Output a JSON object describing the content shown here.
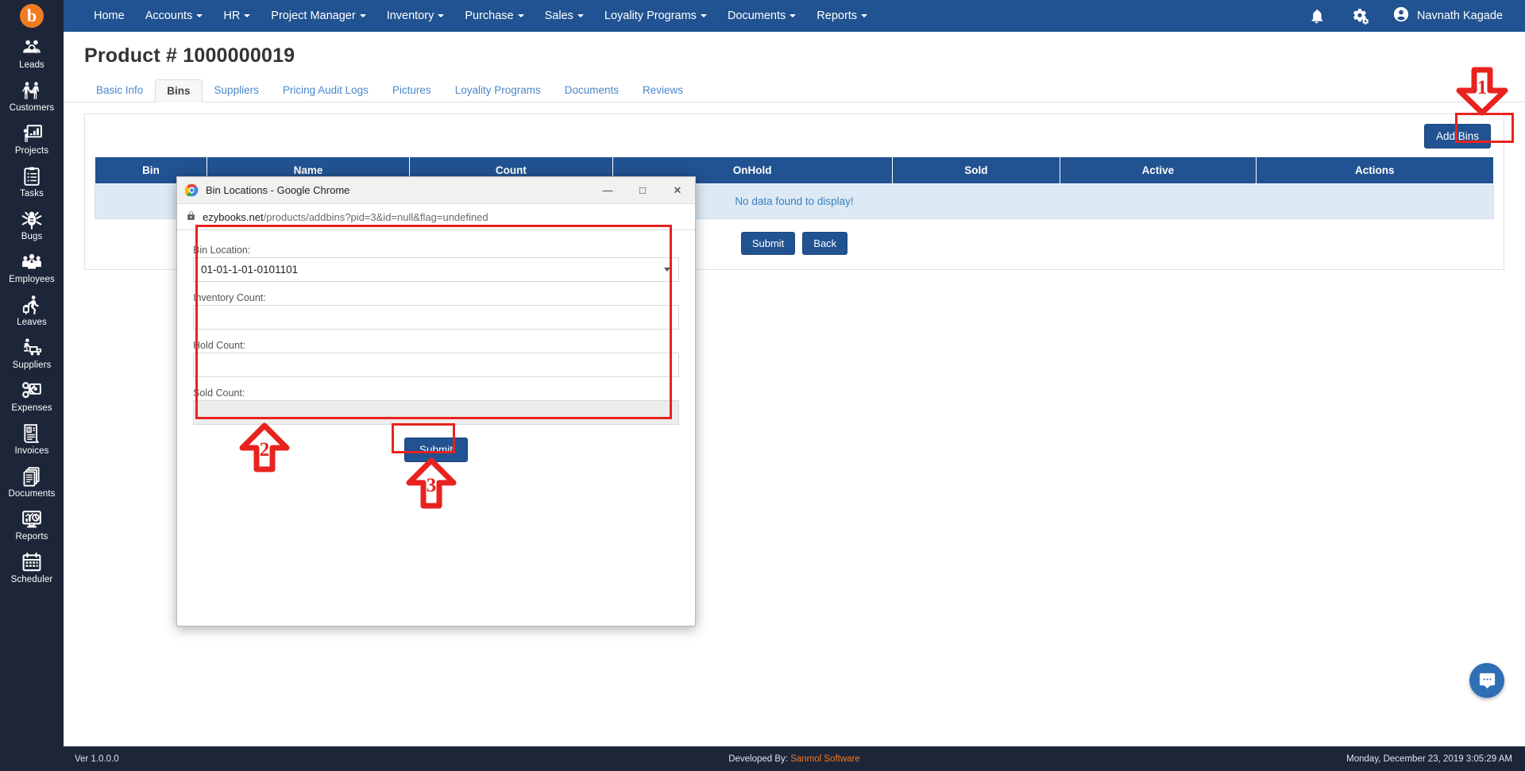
{
  "sidebar": {
    "logo": "b",
    "items": [
      {
        "label": "Leads",
        "icon": "leads-icon"
      },
      {
        "label": "Customers",
        "icon": "customers-icon"
      },
      {
        "label": "Projects",
        "icon": "projects-icon"
      },
      {
        "label": "Tasks",
        "icon": "tasks-icon"
      },
      {
        "label": "Bugs",
        "icon": "bugs-icon"
      },
      {
        "label": "Employees",
        "icon": "employees-icon"
      },
      {
        "label": "Leaves",
        "icon": "leaves-icon"
      },
      {
        "label": "Suppliers",
        "icon": "suppliers-icon"
      },
      {
        "label": "Expenses",
        "icon": "expenses-icon"
      },
      {
        "label": "Invoices",
        "icon": "invoices-icon"
      },
      {
        "label": "Documents",
        "icon": "documents-icon"
      },
      {
        "label": "Reports",
        "icon": "reports-icon"
      },
      {
        "label": "Scheduler",
        "icon": "scheduler-icon"
      }
    ]
  },
  "topnav": {
    "items": [
      {
        "label": "Home",
        "dropdown": false
      },
      {
        "label": "Accounts",
        "dropdown": true
      },
      {
        "label": "HR",
        "dropdown": true
      },
      {
        "label": "Project Manager",
        "dropdown": true
      },
      {
        "label": "Inventory",
        "dropdown": true
      },
      {
        "label": "Purchase",
        "dropdown": true
      },
      {
        "label": "Sales",
        "dropdown": true
      },
      {
        "label": "Loyality Programs",
        "dropdown": true
      },
      {
        "label": "Documents",
        "dropdown": true
      },
      {
        "label": "Reports",
        "dropdown": true
      }
    ],
    "notification_icon": "bell-icon",
    "settings_icon": "gears-icon",
    "user_name": "Navnath Kagade",
    "user_avatar_icon": "user-avatar-icon"
  },
  "page": {
    "title": "Product # 1000000019",
    "tabs": [
      {
        "label": "Basic Info",
        "active": false
      },
      {
        "label": "Bins",
        "active": true
      },
      {
        "label": "Suppliers",
        "active": false
      },
      {
        "label": "Pricing Audit Logs",
        "active": false
      },
      {
        "label": "Pictures",
        "active": false
      },
      {
        "label": "Loyality Programs",
        "active": false
      },
      {
        "label": "Documents",
        "active": false
      },
      {
        "label": "Reviews",
        "active": false
      }
    ],
    "add_bins_label": "Add Bins",
    "table": {
      "headers": [
        "Bin",
        "Name",
        "Count",
        "OnHold",
        "Sold",
        "Active",
        "Actions"
      ],
      "empty_message": "No data found to display!"
    },
    "submit_label": "Submit",
    "back_label": "Back"
  },
  "popup": {
    "title": "Bin Locations - Google Chrome",
    "url_domain": "ezybooks.net",
    "url_path": "/products/addbins?pid=3&id=null&flag=undefined",
    "lock_icon": "lock-icon",
    "minimize_icon": "minimize-icon",
    "maximize_icon": "maximize-icon",
    "close_icon": "close-icon",
    "fields": [
      {
        "label": "Bin Location:",
        "type": "select",
        "value": "01-01-1-01-0101101",
        "readonly": false
      },
      {
        "label": "Inventory Count:",
        "type": "text",
        "value": "",
        "readonly": false
      },
      {
        "label": "Hold Count:",
        "type": "text",
        "value": "",
        "readonly": false
      },
      {
        "label": "Sold Count:",
        "type": "text",
        "value": "",
        "readonly": true
      }
    ],
    "submit_label": "Submit"
  },
  "annotations": [
    {
      "number": "1",
      "target": "add-bins-button",
      "direction": "down"
    },
    {
      "number": "2",
      "target": "bin-form-fields",
      "direction": "up"
    },
    {
      "number": "3",
      "target": "popup-submit-button",
      "direction": "up"
    }
  ],
  "footer": {
    "version": "Ver 1.0.0.0",
    "developed_prefix": "Developed By:",
    "developed_by": "Sanmol Software",
    "datetime": "Monday, December 23, 2019 3:05:29 AM"
  },
  "chat": {
    "icon": "chat-bubble-icon"
  },
  "colors": {
    "nav_blue": "#215291",
    "sidebar_dark": "#1d2539",
    "accent_orange": "#f07c22",
    "annotation_red": "#e8231f",
    "link_blue": "#4a87c9"
  }
}
